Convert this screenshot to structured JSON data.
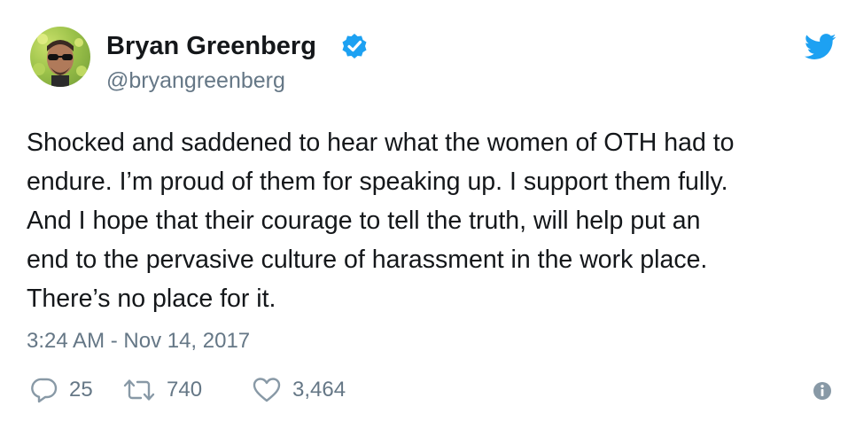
{
  "user": {
    "display_name": "Bryan Greenberg",
    "handle": "@bryangreenberg",
    "verified": true,
    "avatar_icon": "profile-photo"
  },
  "tweet": {
    "lines": [
      "Shocked and saddened to hear what the women of OTH had to",
      "endure. I’m proud of them for speaking up. I support them fully.",
      "And I hope that their courage to tell the truth, will help put an",
      "end to the pervasive culture of harassment in the work place.",
      "There’s no place for it."
    ],
    "timestamp": "3:24 AM - Nov 14, 2017"
  },
  "actions": {
    "reply_count": "25",
    "retweet_count": "740",
    "like_count": "3,464"
  },
  "colors": {
    "text": "#14171a",
    "secondary": "#657786",
    "twitter_blue": "#1da1f2",
    "icon_gray": "#8899a6"
  }
}
